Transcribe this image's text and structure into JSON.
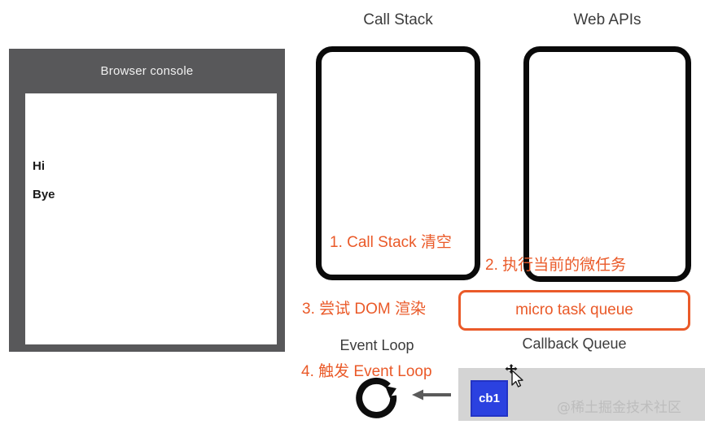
{
  "console": {
    "title": "Browser console",
    "lines": [
      "Hi",
      "Bye"
    ]
  },
  "headings": {
    "call_stack": "Call Stack",
    "web_apis": "Web APIs",
    "callback_queue": "Callback Queue",
    "event_loop": "Event Loop"
  },
  "annotations": [
    {
      "id": "1",
      "text": "1. Call Stack 清空"
    },
    {
      "id": "2",
      "text": "2. 执行当前的微任务"
    },
    {
      "id": "3",
      "text": "3. 尝试 DOM 渲染"
    },
    {
      "id": "4",
      "text": "4. 触发 Event Loop"
    }
  ],
  "micro_task_queue": {
    "label": "micro task queue"
  },
  "callback_queue": {
    "items": [
      "cb1"
    ]
  },
  "watermark": "@稀土掘金技术社区",
  "colors": {
    "annotation_orange": "#ea5a29",
    "console_chrome": "#58585a",
    "callback_item_blue": "#2b41e0",
    "callback_strip_gray": "#d4d4d4",
    "box_black": "#0a0a0a"
  }
}
